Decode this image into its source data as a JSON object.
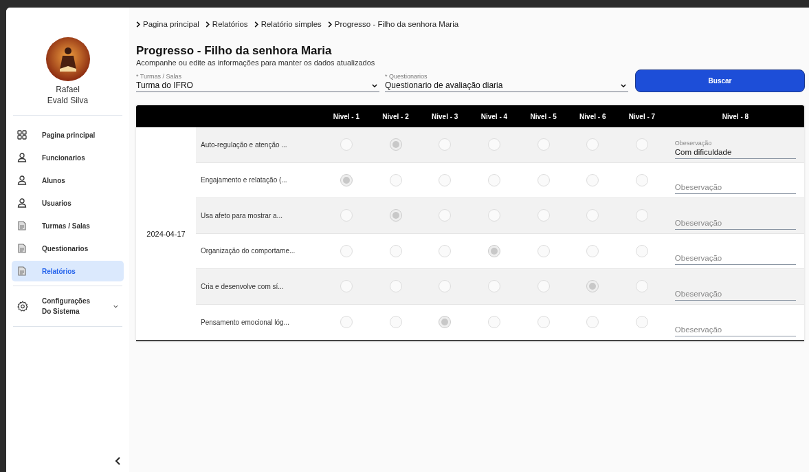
{
  "sidebar": {
    "user": {
      "first_name": "Rafael",
      "last_name": "Evald Silva"
    },
    "items": [
      {
        "label": "Pagina principal",
        "kind": "grid",
        "selected": false
      },
      {
        "label": "Funcionarios",
        "kind": "person",
        "selected": false
      },
      {
        "label": "Alunos",
        "kind": "person",
        "selected": false
      },
      {
        "label": "Usuarios",
        "kind": "person",
        "selected": false
      },
      {
        "label": "Turmas / Salas",
        "kind": "document",
        "selected": false
      },
      {
        "label": "Questionarios",
        "kind": "document",
        "selected": false
      },
      {
        "label": "Relatórios",
        "kind": "document",
        "selected": true
      }
    ],
    "settings": {
      "label": "Configurações Do Sistema",
      "expanded": false
    }
  },
  "breadcrumb": [
    "Pagina principal",
    "Relatórios",
    "Relatório simples",
    "Progresso - Filho da senhora Maria"
  ],
  "page": {
    "title": "Progresso - Filho da senhora Maria",
    "subtitle": "Acompanhe ou edite as informações para manter os dados atualizados"
  },
  "filters": [
    {
      "label": "* Turmas / Salas",
      "value": "Turma do IFRO"
    },
    {
      "label": "* Questionarios",
      "value": "Questionario de avaliação diaria"
    }
  ],
  "search_button": "Buscar",
  "table": {
    "columns": [
      "Nivel - 1",
      "Nivel - 2",
      "Nivel - 3",
      "Nivel - 4",
      "Nivel - 5",
      "Nivel - 6",
      "Nivel - 7",
      "Nivel - 8"
    ],
    "date": "2024-04-17",
    "rows": [
      {
        "item": "Auto-regulação e atenção ...",
        "levels": [
          {
            "selected": false
          },
          {
            "selected": true
          },
          {
            "selected": false
          },
          {
            "selected": false
          },
          {
            "selected": false
          },
          {
            "selected": false
          },
          {
            "selected": false
          }
        ],
        "observation": {
          "label": "Obeservação",
          "value": "Com dificuldade"
        }
      },
      {
        "item": "Engajamento e relatação (...",
        "levels": [
          {
            "selected": true
          },
          {
            "selected": false
          },
          {
            "selected": false
          },
          {
            "selected": false
          },
          {
            "selected": false
          },
          {
            "selected": false
          },
          {
            "selected": false
          }
        ],
        "observation": {
          "placeholder": "Obeservação"
        }
      },
      {
        "item": "Usa afeto para mostrar a...",
        "levels": [
          {
            "selected": false
          },
          {
            "selected": true
          },
          {
            "selected": false
          },
          {
            "selected": false
          },
          {
            "selected": false
          },
          {
            "selected": false
          },
          {
            "selected": false
          }
        ],
        "observation": {
          "placeholder": "Obeservação"
        }
      },
      {
        "item": "Organização do comportame...",
        "levels": [
          {
            "selected": false
          },
          {
            "selected": false
          },
          {
            "selected": false
          },
          {
            "selected": true
          },
          {
            "selected": false
          },
          {
            "selected": false
          },
          {
            "selected": false
          }
        ],
        "observation": {
          "placeholder": "Obeservação"
        }
      },
      {
        "item": "Cria e desenvolve com sí...",
        "levels": [
          {
            "selected": false
          },
          {
            "selected": false
          },
          {
            "selected": false
          },
          {
            "selected": false
          },
          {
            "selected": false
          },
          {
            "selected": true
          },
          {
            "selected": false
          }
        ],
        "observation": {
          "placeholder": "Obeservação"
        }
      },
      {
        "item": "Pensamento emocional lóg...",
        "levels": [
          {
            "selected": false
          },
          {
            "selected": false
          },
          {
            "selected": true
          },
          {
            "selected": false
          },
          {
            "selected": false
          },
          {
            "selected": false
          },
          {
            "selected": false
          }
        ],
        "observation": {
          "placeholder": "Obeservação"
        }
      }
    ]
  }
}
